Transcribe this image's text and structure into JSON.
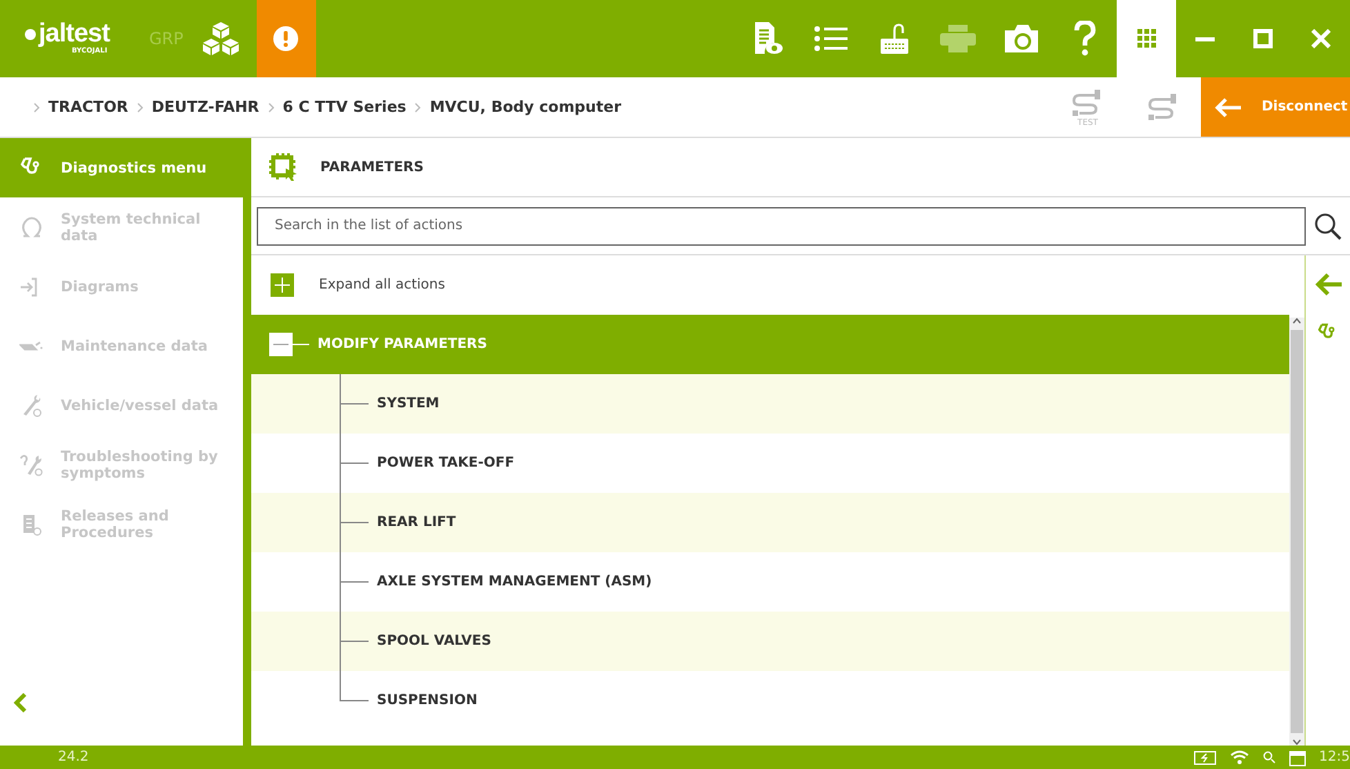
{
  "app": {
    "logo": "jaltest",
    "logo_sub": "BYCOJALI",
    "group": "GRP"
  },
  "breadcrumb": [
    "TRACTOR",
    "DEUTZ-FAHR",
    "6 C TTV Series",
    "MVCU, Body computer"
  ],
  "toolbar": {
    "test_label": "TEST",
    "disconnect": "Disconnect"
  },
  "sidebar": {
    "items": [
      {
        "label": "Diagnostics menu",
        "selected": true,
        "disabled": false
      },
      {
        "label": "System technical data",
        "selected": false,
        "disabled": true
      },
      {
        "label": "Diagrams",
        "selected": false,
        "disabled": true
      },
      {
        "label": "Maintenance data",
        "selected": false,
        "disabled": true
      },
      {
        "label": "Vehicle/vessel data",
        "selected": false,
        "disabled": true
      },
      {
        "label": "Troubleshooting by symptoms",
        "selected": false,
        "disabled": true
      },
      {
        "label": "Releases and Procedures",
        "selected": false,
        "disabled": true
      }
    ]
  },
  "panel": {
    "title": "PARAMETERS",
    "search_placeholder": "Search in the list of actions",
    "expand_all": "Expand all actions"
  },
  "tree": [
    {
      "label": "MODIFY PARAMETERS",
      "expanded": true,
      "selected": true,
      "children": [
        {
          "label": "SYSTEM"
        },
        {
          "label": "POWER TAKE-OFF"
        },
        {
          "label": "REAR LIFT"
        },
        {
          "label": "AXLE SYSTEM MANAGEMENT (ASM)"
        },
        {
          "label": "SPOOL VALVES"
        },
        {
          "label": "SUSPENSION"
        }
      ]
    }
  ],
  "status_bar": {
    "version": "24.2",
    "time": "12:5"
  }
}
